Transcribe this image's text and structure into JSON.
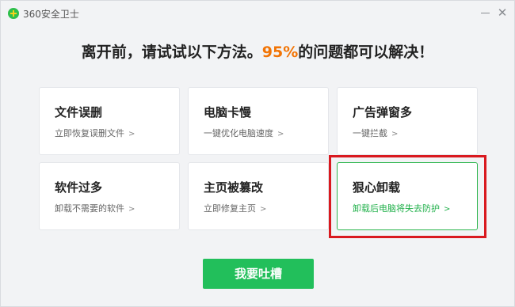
{
  "window": {
    "title": "360安全卫士"
  },
  "headline": {
    "prefix": "离开前，请试试以下方法。",
    "percent": "95%",
    "suffix": "的问题都可以解决！"
  },
  "cards": [
    {
      "title": "文件误删",
      "subtitle": "立即恢复误删文件",
      "arrow": ">"
    },
    {
      "title": "电脑卡慢",
      "subtitle": "一键优化电脑速度",
      "arrow": ">"
    },
    {
      "title": "广告弹窗多",
      "subtitle": "一键拦截",
      "arrow": ">"
    },
    {
      "title": "软件过多",
      "subtitle": "卸载不需要的软件",
      "arrow": ">"
    },
    {
      "title": "主页被篡改",
      "subtitle": "立即修复主页",
      "arrow": ">"
    },
    {
      "title": "狠心卸载",
      "subtitle": "卸载后电脑将失去防护",
      "arrow": ">"
    }
  ],
  "feedback_button": "我要吐槽",
  "colors": {
    "accent_green": "#22bf5b",
    "percent_orange": "#f27405",
    "highlight_red": "#d9191f"
  }
}
